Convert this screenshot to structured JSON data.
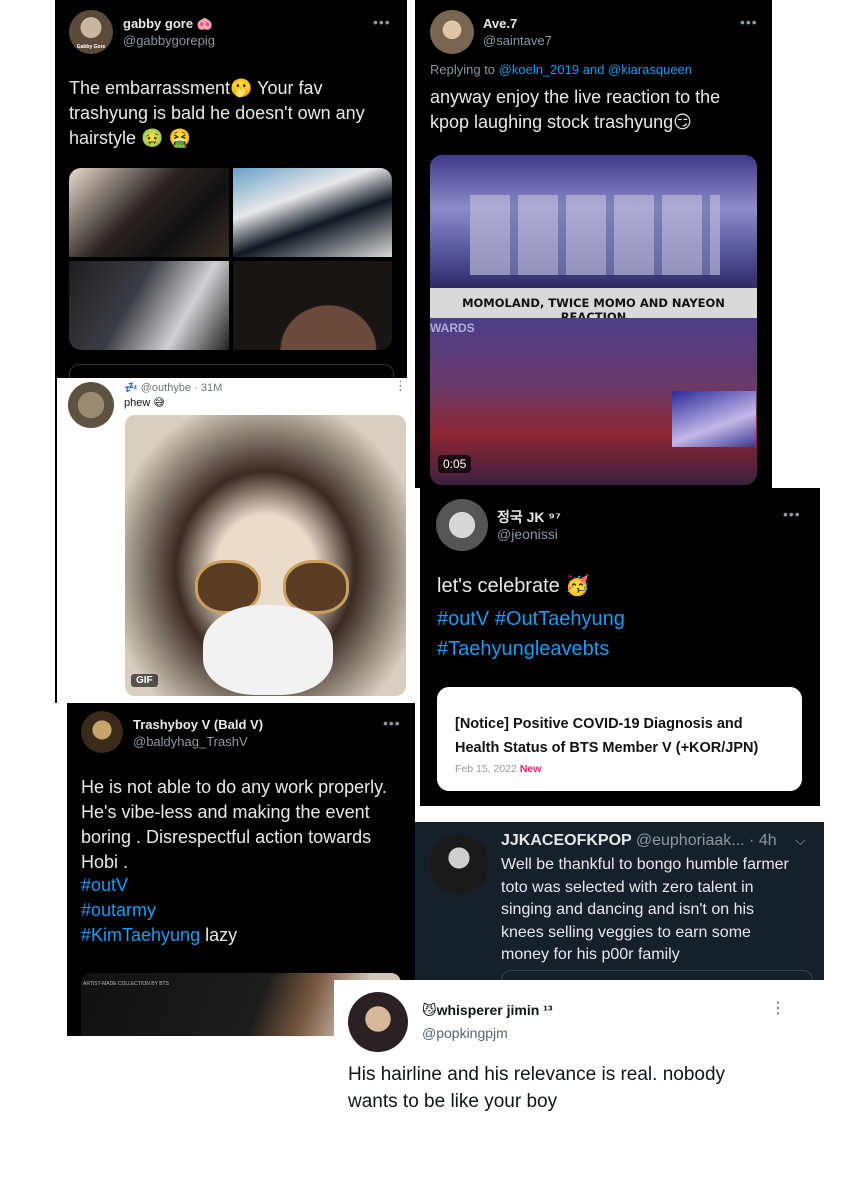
{
  "colors": {
    "twitter_blue": "#1d9bf0",
    "dark_bg": "#000000",
    "dim_bg": "#15202b",
    "red_new": "#e0245e"
  },
  "tweets": {
    "gabby": {
      "name": "gabby gore 🐽",
      "handle": "@gabbygorepig",
      "avatar_caption": "Gabby Gore",
      "body": "The embarrassment🫢 Your fav\ntrashyung is bald he doesn't own any\nhairstyle 🤢 🤮",
      "more_icon": "more-icon"
    },
    "ave": {
      "name": "Ave.7",
      "handle": "@saintave7",
      "replying_prefix": "Replying to ",
      "replying_users": "@koeln_2019 and @kiarasqueen",
      "body": "anyway enjoy the live reaction to the\nkpop laughing stock trashyung😏",
      "video_caption": "MOMOLAND, TWICE MOMO AND NAYEON REACTION",
      "video_overlay": "WARDS",
      "video_time": "0:05"
    },
    "outhybe": {
      "handle_line": "💤 @outhybe · 31M",
      "body": "phew 😅",
      "gif_badge": "GIF"
    },
    "jk": {
      "name": "정국 JK ⁹⁷",
      "handle": "@jeonissi",
      "body": "let's celebrate 🥳",
      "hashtags": [
        "#outV #OutTaehyung",
        "#Taehyungleavebts"
      ],
      "card_title": "[Notice] Positive COVID-19 Diagnosis and Health Status of BTS Member V (+KOR/JPN)",
      "card_date": "Feb 15, 2022",
      "card_new": "New"
    },
    "trashyboy": {
      "name": "Trashyboy V (Bald V)",
      "handle": "@baldyhag_TrashV",
      "body": "He is not able to do any work properly.\nHe's vibe-less and making the event\nboring . Disrespectful action towards\nHobi .",
      "tags": [
        "#outV",
        "#outarmy"
      ],
      "last_tag": "#KimTaehyung",
      "last_suffix": " lazy",
      "media_caption": "ARTIST-MADE COLLECTION BY BTS"
    },
    "jjk": {
      "name": "JJKACEOFKPOP",
      "handle": "@euphoriaak...",
      "time": " · 4h",
      "body": "Well be thankful to bongo humble farmer\ntoto was selected with zero talent in\nsinging and dancing and isn't on his\nknees selling veggies to earn some\nmoney for his p00r family"
    },
    "whisperer": {
      "name": "😼whisperer jimin ¹³",
      "handle": "@popkingpjm",
      "body": "His hairline and his relevance is real. nobody\nwants to be like your boy"
    }
  }
}
